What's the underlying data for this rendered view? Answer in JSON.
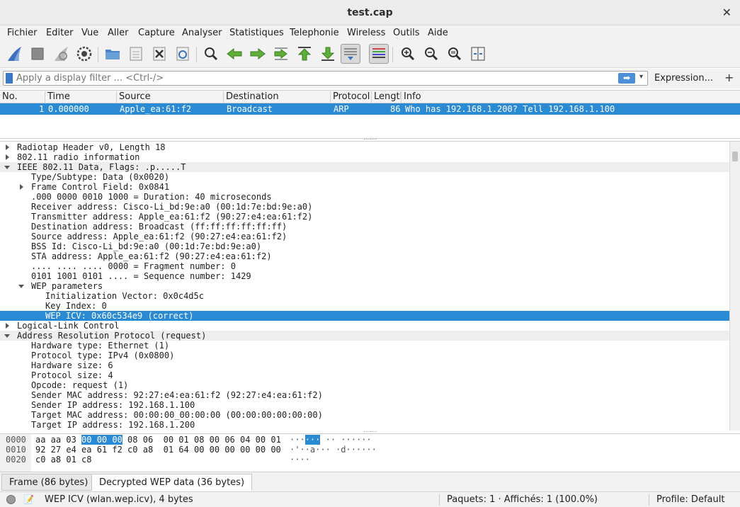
{
  "window": {
    "title": "test.cap",
    "close_glyph": "✕"
  },
  "menu": [
    "Fichier",
    "Editer",
    "Vue",
    "Aller",
    "Capture",
    "Analyser",
    "Statistiques",
    "Telephonie",
    "Wireless",
    "Outils",
    "Aide"
  ],
  "toolbar": {
    "icons": [
      "shark-fin-start-icon",
      "stop-capture-icon",
      "restart-capture-icon",
      "capture-options-icon",
      "open-file-icon",
      "save-file-icon",
      "close-file-icon",
      "reload-file-icon",
      "find-packet-icon",
      "go-back-icon",
      "go-forward-icon",
      "go-to-packet-icon",
      "go-first-icon",
      "go-last-icon",
      "autoscroll-icon",
      "colorize-icon",
      "zoom-in-icon",
      "zoom-out-icon",
      "zoom-reset-icon",
      "resize-columns-icon"
    ]
  },
  "filter": {
    "placeholder": "Apply a display filter ... <Ctrl-/>",
    "apply_glyph": "➡",
    "dropdown_glyph": "▾",
    "expression_label": "Expression...",
    "add_label": "+"
  },
  "packet_list": {
    "columns": [
      "No.",
      "Time",
      "Source",
      "Destination",
      "Protocol",
      "Length",
      "Info"
    ],
    "rows": [
      {
        "no": "1",
        "time": "0.000000",
        "source": "Apple_ea:61:f2",
        "destination": "Broadcast",
        "protocol": "ARP",
        "length": "86",
        "info": "Who has 192.168.1.200? Tell 192.168.1.100"
      }
    ]
  },
  "details": [
    {
      "text": "Radiotap Header v0, Length 18",
      "indent": 0,
      "arrow": "r",
      "style": ""
    },
    {
      "text": "802.11 radio information",
      "indent": 0,
      "arrow": "r",
      "style": ""
    },
    {
      "text": "IEEE 802.11 Data, Flags: .p.....T",
      "indent": 0,
      "arrow": "d",
      "style": "sub"
    },
    {
      "text": "Type/Subtype: Data (0x0020)",
      "indent": 1,
      "arrow": "",
      "style": ""
    },
    {
      "text": "Frame Control Field: 0x0841",
      "indent": 1,
      "arrow": "r",
      "style": ""
    },
    {
      "text": ".000 0000 0010 1000 = Duration: 40 microseconds",
      "indent": 1,
      "arrow": "",
      "style": ""
    },
    {
      "text": "Receiver address: Cisco-Li_bd:9e:a0 (00:1d:7e:bd:9e:a0)",
      "indent": 1,
      "arrow": "",
      "style": ""
    },
    {
      "text": "Transmitter address: Apple_ea:61:f2 (90:27:e4:ea:61:f2)",
      "indent": 1,
      "arrow": "",
      "style": ""
    },
    {
      "text": "Destination address: Broadcast (ff:ff:ff:ff:ff:ff)",
      "indent": 1,
      "arrow": "",
      "style": ""
    },
    {
      "text": "Source address: Apple_ea:61:f2 (90:27:e4:ea:61:f2)",
      "indent": 1,
      "arrow": "",
      "style": ""
    },
    {
      "text": "BSS Id: Cisco-Li_bd:9e:a0 (00:1d:7e:bd:9e:a0)",
      "indent": 1,
      "arrow": "",
      "style": ""
    },
    {
      "text": "STA address: Apple_ea:61:f2 (90:27:e4:ea:61:f2)",
      "indent": 1,
      "arrow": "",
      "style": ""
    },
    {
      "text": ".... .... .... 0000 = Fragment number: 0",
      "indent": 1,
      "arrow": "",
      "style": ""
    },
    {
      "text": "0101 1001 0101 .... = Sequence number: 1429",
      "indent": 1,
      "arrow": "",
      "style": ""
    },
    {
      "text": "WEP parameters",
      "indent": 1,
      "arrow": "d",
      "style": ""
    },
    {
      "text": "Initialization Vector: 0x0c4d5c",
      "indent": 2,
      "arrow": "",
      "style": ""
    },
    {
      "text": "Key Index: 0",
      "indent": 2,
      "arrow": "",
      "style": ""
    },
    {
      "text": "WEP ICV: 0x60c534e9 (correct)",
      "indent": 2,
      "arrow": "",
      "style": "sel"
    },
    {
      "text": "Logical-Link Control",
      "indent": 0,
      "arrow": "r",
      "style": ""
    },
    {
      "text": "Address Resolution Protocol (request)",
      "indent": 0,
      "arrow": "d",
      "style": "sub"
    },
    {
      "text": "Hardware type: Ethernet (1)",
      "indent": 1,
      "arrow": "",
      "style": ""
    },
    {
      "text": "Protocol type: IPv4 (0x0800)",
      "indent": 1,
      "arrow": "",
      "style": ""
    },
    {
      "text": "Hardware size: 6",
      "indent": 1,
      "arrow": "",
      "style": ""
    },
    {
      "text": "Protocol size: 4",
      "indent": 1,
      "arrow": "",
      "style": ""
    },
    {
      "text": "Opcode: request (1)",
      "indent": 1,
      "arrow": "",
      "style": ""
    },
    {
      "text": "Sender MAC address: 92:27:e4:ea:61:f2 (92:27:e4:ea:61:f2)",
      "indent": 1,
      "arrow": "",
      "style": ""
    },
    {
      "text": "Sender IP address: 192.168.1.100",
      "indent": 1,
      "arrow": "",
      "style": ""
    },
    {
      "text": "Target MAC address: 00:00:00_00:00:00 (00:00:00:00:00:00)",
      "indent": 1,
      "arrow": "",
      "style": ""
    },
    {
      "text": "Target IP address: 192.168.1.200",
      "indent": 1,
      "arrow": "",
      "style": ""
    }
  ],
  "hex": [
    {
      "offset": "0000",
      "bytes_pre": "aa aa 03 ",
      "bytes_hl": "00 00 00",
      "bytes_post": " 08 06  00 01 08 00 06 04 00 01",
      "ascii_pre": "···",
      "ascii_hl": "···",
      "ascii_post": " ·· ······"
    },
    {
      "offset": "0010",
      "bytes_pre": "92 27 e4 ea 61 f2 c0 a8  01 64 00 00 00 00 00 00",
      "bytes_hl": "",
      "bytes_post": "",
      "ascii_pre": "·'··a··· ·d······",
      "ascii_hl": "",
      "ascii_post": ""
    },
    {
      "offset": "0020",
      "bytes_pre": "c0 a8 01 c8",
      "bytes_hl": "",
      "bytes_post": "",
      "ascii_pre": "····",
      "ascii_hl": "",
      "ascii_post": ""
    }
  ],
  "tabs": [
    {
      "label": "Frame (86 bytes)",
      "active": false
    },
    {
      "label": "Decrypted WEP data (36 bytes)",
      "active": true
    }
  ],
  "status": {
    "field_info": "WEP ICV (wlan.wep.icv), 4 bytes",
    "packets": "Paquets: 1 · Affichés: 1 (100.0%)",
    "profile": "Profile: Default"
  },
  "colors": {
    "selection": "#2a8ad4",
    "accent_blue": "#3a78c8"
  }
}
